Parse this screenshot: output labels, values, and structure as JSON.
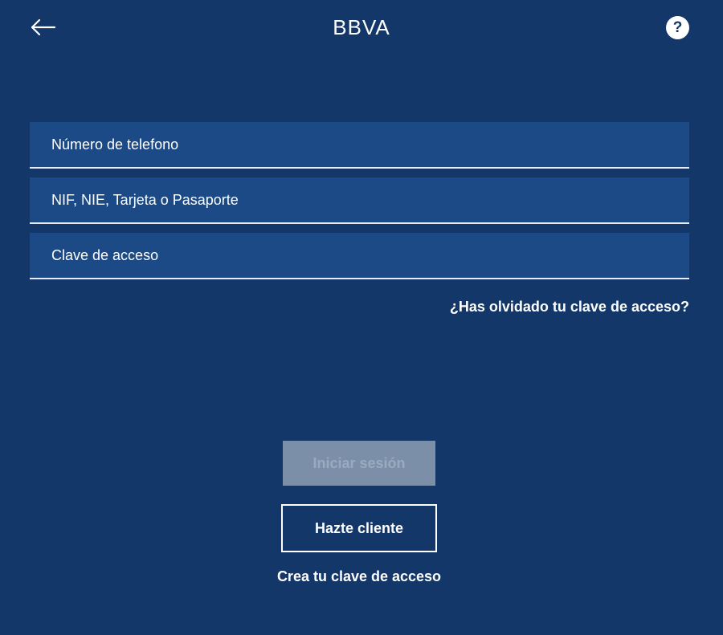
{
  "header": {
    "logo_text": "BBVA",
    "help_label": "?"
  },
  "form": {
    "fields": [
      {
        "label": "Número de telefono"
      },
      {
        "label": "NIF, NIE, Tarjeta o Pasaporte"
      },
      {
        "label": "Clave de acceso"
      }
    ],
    "forgot_link": "¿Has olvidado tu clave de acceso?"
  },
  "actions": {
    "login_label": "Iniciar sesión",
    "signup_label": "Hazte cliente",
    "create_link": "Crea tu clave de acceso"
  },
  "icons": {
    "back": "arrow-left-icon",
    "help": "question-mark-icon"
  },
  "colors": {
    "background": "#133769",
    "field_background": "#1b4a86",
    "disabled_button": "#7c8fa9"
  }
}
